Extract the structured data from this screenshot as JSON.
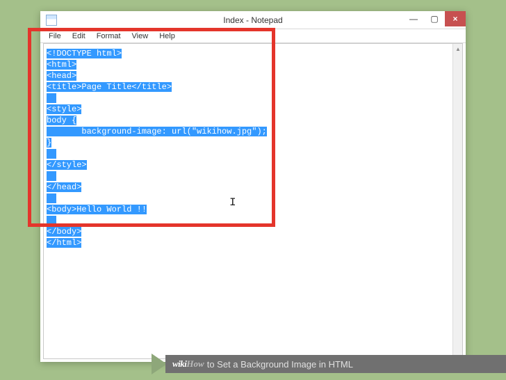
{
  "window": {
    "title": "Index - Notepad",
    "controls": {
      "min": "—",
      "max": "▢",
      "close": "×"
    }
  },
  "menubar": [
    "File",
    "Edit",
    "Format",
    "View",
    "Help"
  ],
  "code_lines": [
    "<!DOCTYPE html>",
    "<html>",
    "<head>",
    "<title>Page Title</title>",
    "",
    "<style>",
    "body {",
    "       background-image: url(\"wikihow.jpg\");",
    "}",
    "",
    "</style>",
    "",
    "</head>",
    "",
    "<body>Hello World !!",
    "",
    "</body>",
    "</html>"
  ],
  "footer": {
    "brand1": "wiki",
    "brand2": "How",
    "rest": " to Set a Background Image in HTML"
  }
}
